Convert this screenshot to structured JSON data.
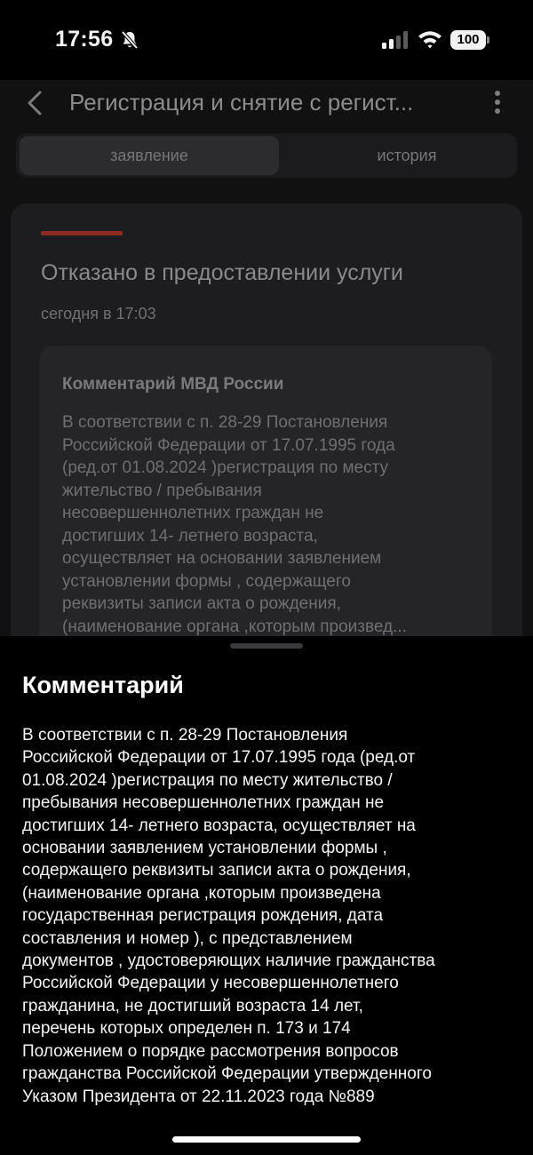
{
  "status_bar": {
    "time": "17:56",
    "battery": "100"
  },
  "header": {
    "title": "Регистрация и снятие с регист..."
  },
  "tabs": [
    {
      "label": "заявление"
    },
    {
      "label": "история"
    }
  ],
  "status_card": {
    "title": "Отказано в предоставлении услуги",
    "time": "сегодня в 17:03",
    "comment": {
      "author": "Комментарий МВД России",
      "preview": "В соответствии с п. 28-29 Постановления\nРоссийской Федерации от 17.07.1995 года\n(ред.от 01.08.2024 )регистрация по месту\nжительство / пребывания\nнесовершеннолетних граждан не\nдостигших 14- летнего возраста,\nосуществляет на основании заявлением\nустановлении формы , содержащего\nреквизиты записи акта о рождения,\n(наименование органа ,которым произвед..."
    }
  },
  "sheet": {
    "title": "Комментарий",
    "body": "В соответствии с п. 28-29 Постановления\nРоссийской Федерации от 17.07.1995 года (ред.от\n01.08.2024 )регистрация по месту жительство /\nпребывания несовершеннолетних граждан не\nдостигших 14- летнего возраста, осуществляет на\nосновании заявлением установлении формы ,\nсодержащего реквизиты записи акта о рождения,\n(наименование органа ,которым произведена\nгосударственная регистрация рождения, дата\nсоставления и номер ), с представлением\nдокументов , удостоверяющих наличие гражданства\nРоссийской Федерации у несовершеннолетнего\nгражданина, не достигший возраста 14 лет,\nперечень которых определен п. 173 и 174\nПоложением о порядке рассмотрения вопросов\nгражданства Российской Федерации утвержденного\nУказом Президента от 22.11.2023 года №889"
  },
  "icons": {
    "back": "chevron-left-icon",
    "more": "more-vertical-icon",
    "mute": "bell-slash-icon",
    "signal": "cellular-signal-icon",
    "wifi": "wifi-icon"
  },
  "colors": {
    "status_stripe": "#8e2a22",
    "sheet_background": "#000000",
    "card_background": "#1d1d1f"
  }
}
